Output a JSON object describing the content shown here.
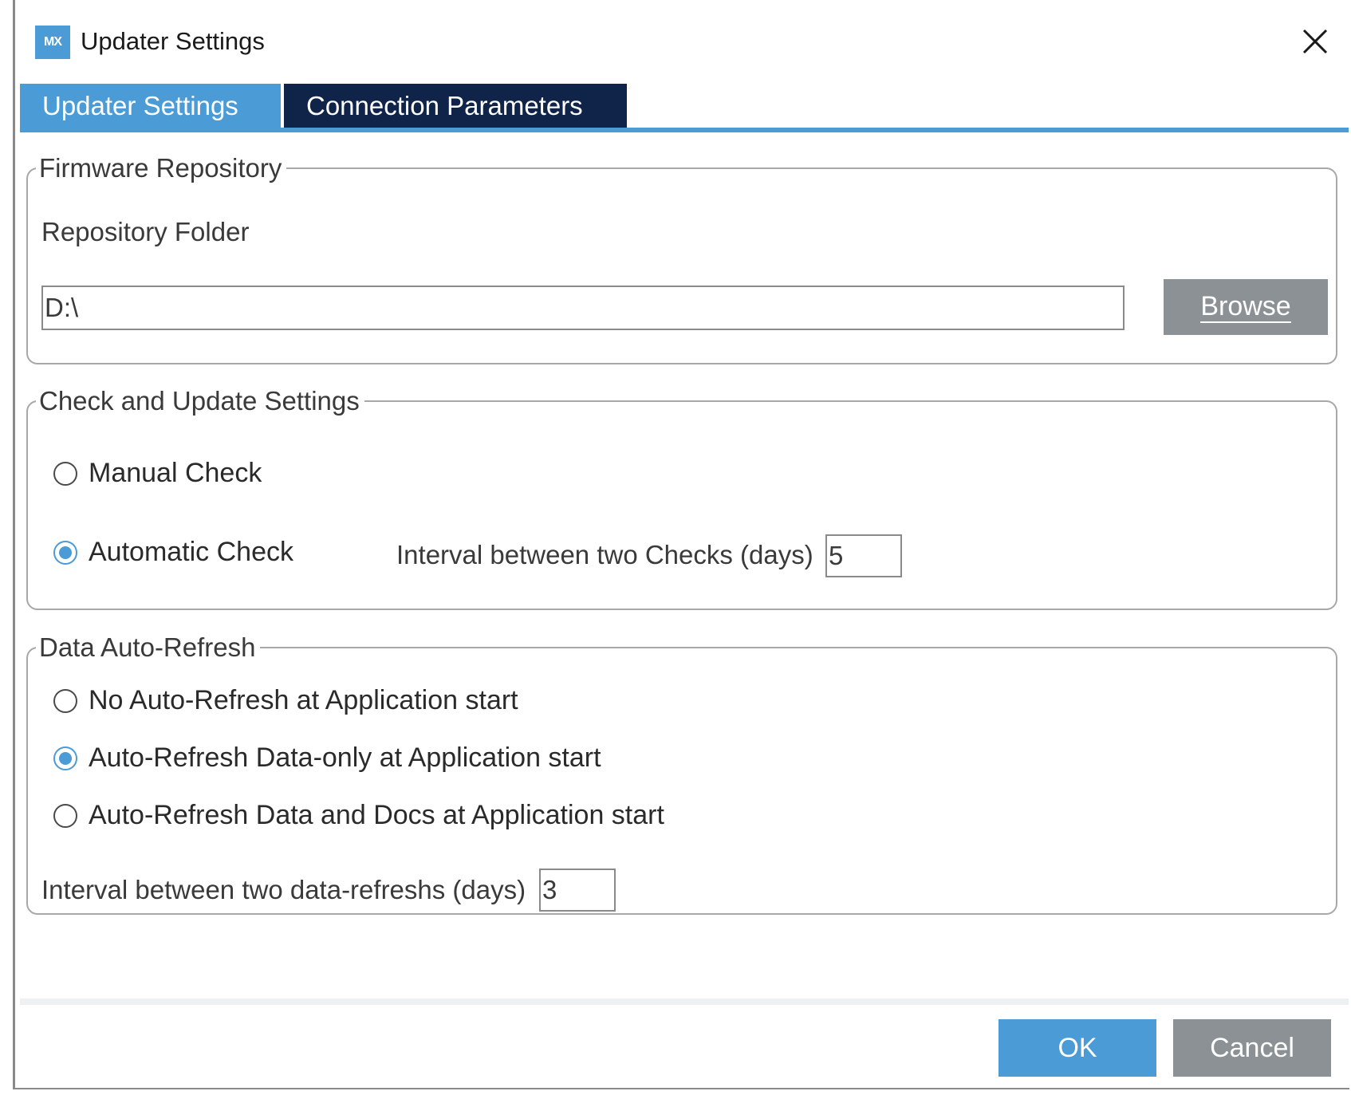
{
  "window": {
    "icon_text": "MX",
    "title": "Updater Settings"
  },
  "tabs": [
    {
      "label": "Updater Settings",
      "active": true
    },
    {
      "label": "Connection Parameters",
      "active": false
    }
  ],
  "firmware_repository": {
    "legend": "Firmware Repository",
    "folder_label": "Repository Folder",
    "folder_value": "D:\\",
    "browse_label": "Browse"
  },
  "check_update": {
    "legend": "Check and Update Settings",
    "manual_label": "Manual Check",
    "manual_selected": false,
    "automatic_label": "Automatic Check",
    "automatic_selected": true,
    "interval_label": "Interval between two Checks (days)",
    "interval_value": "5"
  },
  "data_refresh": {
    "legend": "Data Auto-Refresh",
    "options": [
      {
        "label": "No Auto-Refresh at Application start",
        "selected": false
      },
      {
        "label": "Auto-Refresh Data-only at Application start",
        "selected": true
      },
      {
        "label": "Auto-Refresh Data and Docs at Application start",
        "selected": false
      }
    ],
    "interval_label": "Interval between two data-refreshs (days)",
    "interval_value": "3"
  },
  "footer": {
    "ok_label": "OK",
    "cancel_label": "Cancel"
  },
  "colors": {
    "accent": "#4a9bd6",
    "tab_inactive": "#0f2448",
    "button_gray": "#8c9196"
  }
}
